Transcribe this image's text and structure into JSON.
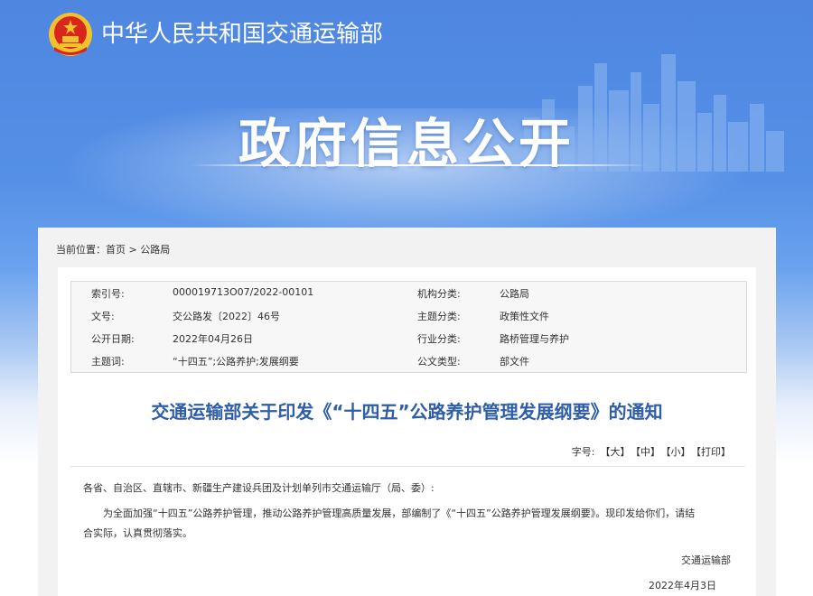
{
  "header": {
    "ministry_name": "中华人民共和国交通运输部",
    "section_title": "政府信息公开"
  },
  "breadcrumb": {
    "prefix": "当前位置：",
    "home": "首页",
    "separator": " > ",
    "current": "公路局"
  },
  "meta": {
    "index_label": "索引号:",
    "index_value": "000019713O07/2022-00101",
    "org_label": "机构分类:",
    "org_value": "公路局",
    "doc_no_label": "文号:",
    "doc_no_value": "交公路发〔2022〕46号",
    "topic_label": "主题分类:",
    "topic_value": "政策性文件",
    "date_label": "公开日期:",
    "date_value": "2022年04月26日",
    "industry_label": "行业分类:",
    "industry_value": "路桥管理与养护",
    "keywords_label": "主题词:",
    "keywords_value": "“十四五”;公路养护;发展纲要",
    "doctype_label": "公文类型:",
    "doctype_value": "部文件"
  },
  "article": {
    "title": "交通运输部关于印发《“十四五”公路养护管理发展纲要》的通知",
    "fontsize_label": "字号:",
    "large": "【大】",
    "medium": "【中】",
    "small": "【小】",
    "print": "【打印】",
    "recipients": "各省、自治区、直辖市、新疆生产建设兵团及计划单列市交通运输厅（局、委）:",
    "body_line1": "为全面加强“十四五”公路养护管理，推动公路养护管理高质量发展，部编制了《“十四五”公路养护管理发展纲要》。现印发给你们，请结",
    "body_line2": "合实际，认真贯彻落实。",
    "signature": "交通运输部",
    "sign_date": "2022年4月3日"
  },
  "colors": {
    "header_blue": "#5590e6",
    "title_blue": "#2f5ea8",
    "emblem_red": "#d9261c",
    "emblem_gold": "#f2c12e"
  }
}
